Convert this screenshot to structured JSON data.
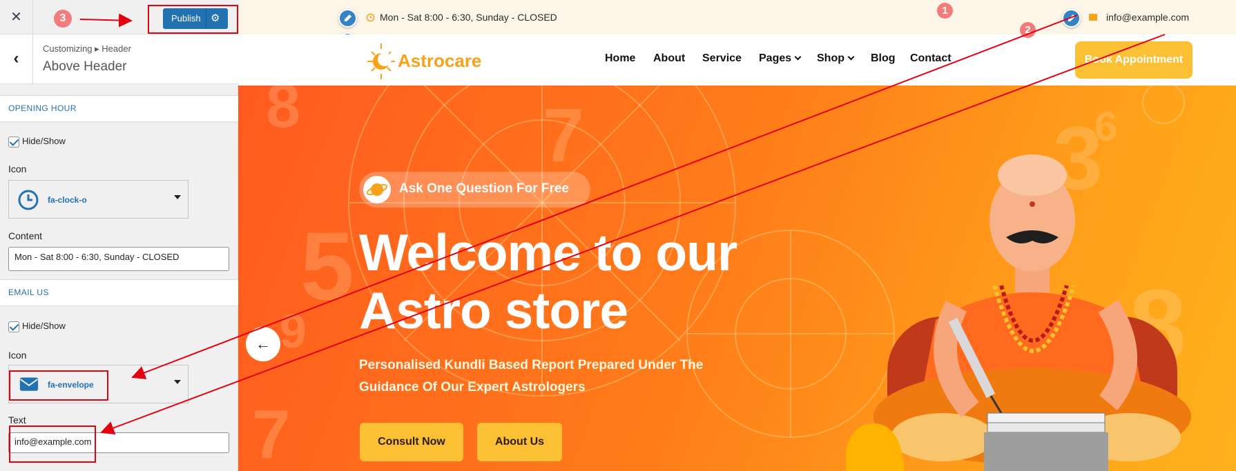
{
  "customizer": {
    "close_label": "✕",
    "publish_label": "Publish",
    "breadcrumb": "Customizing ▸ Header",
    "section_title": "Above Header",
    "opening_hour": {
      "group_title": "OPENING HOUR",
      "toggle_label": "Hide/Show",
      "icon_label": "Icon",
      "icon_value": "fa-clock-o",
      "content_label": "Content",
      "content_value": "Mon - Sat 8:00 - 6:30, Sunday - CLOSED"
    },
    "email_us": {
      "group_title": "EMAIL US",
      "toggle_label": "Hide/Show",
      "icon_label": "Icon",
      "icon_value": "fa-envelope",
      "text_label": "Text",
      "text_value": "info@example.com"
    }
  },
  "annotations": {
    "step_1": "1",
    "step_2": "2",
    "step_3": "3",
    "color": "#e3000f"
  },
  "site": {
    "hours": "Mon - Sat 8:00 - 6:30, Sunday - CLOSED",
    "email": "info@example.com",
    "logo_text": "Astrocare",
    "nav": [
      "Home",
      "About",
      "Service",
      "Pages",
      "Shop",
      "Blog",
      "Contact"
    ],
    "book_button": "Book Appointment",
    "pill_text": "Ask One Question For Free",
    "hero_title_line1": "Welcome to our",
    "hero_title_line2": "Astro store",
    "hero_subtitle_line1": "Personalised Kundli Based Report Prepared Under The",
    "hero_subtitle_line2": "Guidance Of Our Expert Astrologers",
    "consult_button": "Consult Now",
    "about_button": "About Us",
    "accent_color": "#fcc035",
    "hero_color": "#ff7a1a"
  }
}
